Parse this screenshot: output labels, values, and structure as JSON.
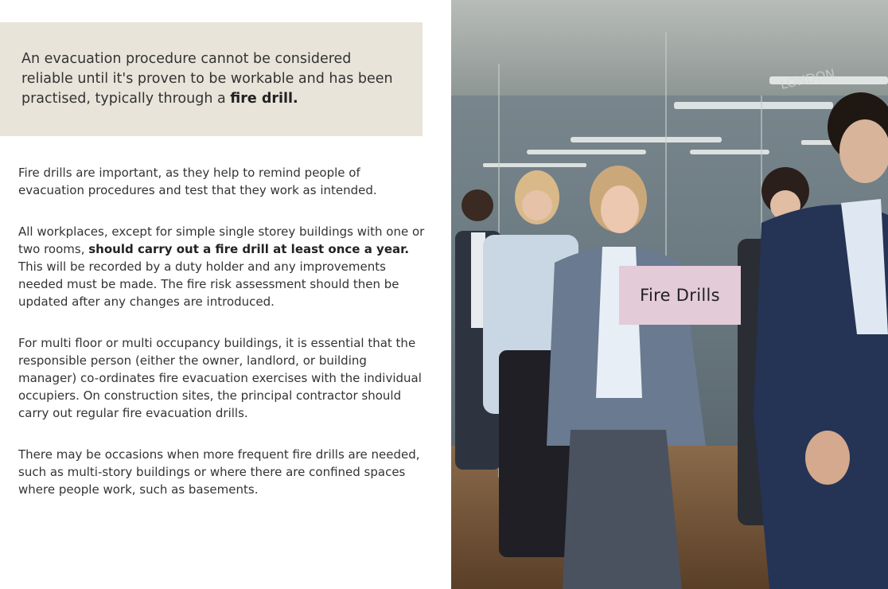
{
  "callout": {
    "text_before": "An evacuation procedure cannot be considered reliable until it's proven to be workable and has been practised, typically through a ",
    "text_bold": "fire drill."
  },
  "paragraphs": {
    "p1": "Fire drills are important, as they help to remind people of evacuation procedures and test that they work as intended.",
    "p2_before": "All workplaces, except for simple single storey buildings with one or two rooms, ",
    "p2_bold": "should carry out a fire drill at least once a year.",
    "p2_after": " This will be recorded by a duty holder and any improvements needed must be made. The fire risk assessment should then be updated after any changes are introduced.",
    "p3": "For multi floor or multi occupancy buildings, it is essential that the responsible person (either the owner, landlord, or building manager) co-ordinates fire evacuation exercises with the individual occupiers. On construction sites, the principal contractor should carry out regular fire evacuation drills.",
    "p4": "There may be occasions when more frequent fire drills are needed, such as multi-story buildings or where there are confined spaces where people work, such as basements."
  },
  "photo": {
    "label": "Fire Drills",
    "sign_text": "LONDON"
  },
  "colors": {
    "callout_bg": "#e8e4da",
    "label_bg": "#e3cbd7"
  }
}
